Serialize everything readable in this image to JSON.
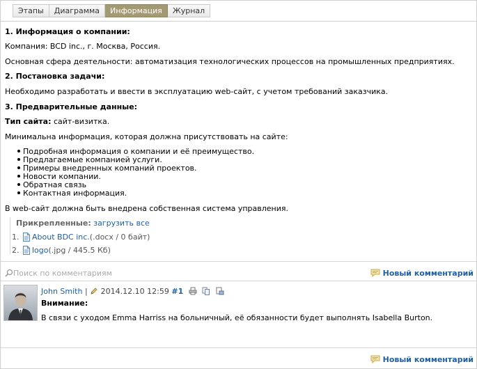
{
  "tabs": [
    {
      "label": "Этапы",
      "active": false
    },
    {
      "label": "Диаграмма",
      "active": false
    },
    {
      "label": "Информация",
      "active": true
    },
    {
      "label": "Журнал",
      "active": false
    }
  ],
  "info": {
    "h1": "1. Информация о компании:",
    "company": "Компания: BCD inc., г. Москва, Россия.",
    "activity": "Основная сфера деятельности: автоматизация технологических процессов на промышленных предприятиях.",
    "h2": "2. Постановка задачи:",
    "task": "Необходимо разработать и ввести в эксплуатацию web-сайт, с учетом требований заказчика.",
    "h3": "3. Предварительные данные:",
    "site_type_label": "Тип сайта:",
    "site_type_value": " сайт-визитка.",
    "min_info": "Минимальна информация, которая должна присутствовать на сайте:",
    "items": [
      "Подробная информация о компании и её преимущество.",
      "Предлагаемые компанией услуги.",
      "Примеры внедренных компаний проектов.",
      "Новости компании.",
      "Обратная связь",
      "Контактная информация."
    ],
    "cms": "В web-сайт должна быть внедрена собственная система управления."
  },
  "attachments": {
    "label": "Прикрепленные:",
    "download_all": "загрузить все",
    "files": [
      {
        "index": "1.",
        "name": "About BDC inc.",
        "meta": "(.docx / 0 байт)"
      },
      {
        "index": "2.",
        "name": "logo",
        "meta": "(.jpg / 445.5 Кб)"
      }
    ]
  },
  "comments_bar": {
    "search_placeholder": "Поиск по комментариям",
    "new_comment": "Новый комментарий"
  },
  "comment": {
    "author": "John Smith",
    "sep": "|",
    "datetime": "2014.12.10 12:59",
    "number": "#1",
    "title": "Внимание:",
    "text": "В связи с уходом Emma Harriss на больничный, её обязанности будет выполнять Isabella Burton."
  },
  "footer": {
    "new_comment": "Новый комментарий"
  },
  "colors": {
    "active_tab": "#a39a74",
    "link": "#1f5fa8"
  }
}
